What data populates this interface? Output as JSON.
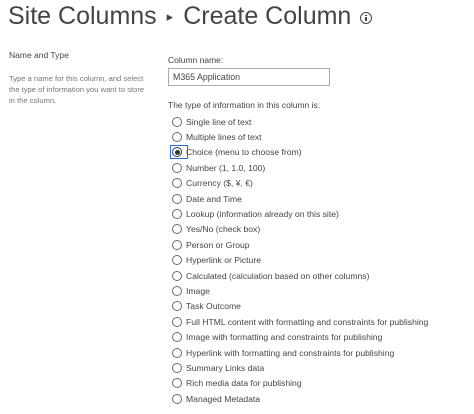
{
  "header": {
    "breadcrumb_root": "Site Columns",
    "separator": "▸",
    "page_title": "Create Column",
    "info_icon": "info-icon"
  },
  "name_and_type": {
    "section_title": "Name and Type",
    "section_description": "Type a name for this column, and select the type of information you want to store in the column.",
    "column_name_label": "Column name:",
    "column_name_value": "M365 Application",
    "type_prompt": "The type of information in this column is:",
    "selected_index": 2,
    "options": [
      {
        "label": "Single line of text"
      },
      {
        "label": "Multiple lines of text"
      },
      {
        "label": "Choice (menu to choose from)"
      },
      {
        "label": "Number (1, 1.0, 100)"
      },
      {
        "label": "Currency ($, ¥, €)"
      },
      {
        "label": "Date and Time"
      },
      {
        "label": "Lookup (information already on this site)"
      },
      {
        "label": "Yes/No (check box)"
      },
      {
        "label": "Person or Group"
      },
      {
        "label": "Hyperlink or Picture"
      },
      {
        "label": "Calculated (calculation based on other columns)"
      },
      {
        "label": "Image"
      },
      {
        "label": "Task Outcome"
      },
      {
        "label": "Full HTML content with formatting and constraints for publishing"
      },
      {
        "label": "Image with formatting and constraints for publishing"
      },
      {
        "label": "Hyperlink with formatting and constraints for publishing"
      },
      {
        "label": "Summary Links data"
      },
      {
        "label": "Rich media data for publishing"
      },
      {
        "label": "Managed Metadata"
      }
    ]
  },
  "colors": {
    "text": "#444444",
    "muted_text": "#777777",
    "focus_ring": "#2a6fd6",
    "input_border": "#ababab"
  }
}
